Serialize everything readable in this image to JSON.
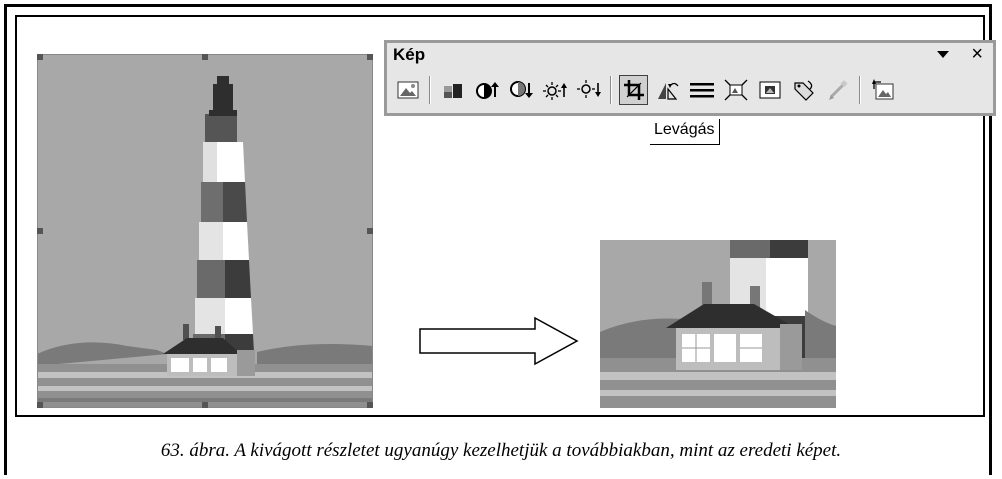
{
  "toolbar": {
    "title": "Kép",
    "dropdown_icon": "dropdown-arrow-icon",
    "close_label": "×",
    "buttons": [
      {
        "name": "insert-picture-icon"
      },
      {
        "name": "color-icon"
      },
      {
        "name": "more-contrast-icon"
      },
      {
        "name": "less-contrast-icon"
      },
      {
        "name": "more-brightness-icon"
      },
      {
        "name": "less-brightness-icon"
      },
      {
        "name": "crop-icon",
        "active": true
      },
      {
        "name": "rotate-left-icon"
      },
      {
        "name": "line-style-icon"
      },
      {
        "name": "compress-pictures-icon"
      },
      {
        "name": "text-wrapping-icon"
      },
      {
        "name": "format-picture-icon"
      },
      {
        "name": "set-transparent-color-icon"
      },
      {
        "name": "reset-picture-icon"
      }
    ]
  },
  "tooltip": {
    "text": "Levágás"
  },
  "caption": {
    "text": "63. ábra. A kivágott részletet ugyanúgy kezelhetjük a továbbiakban, mint az eredeti képet."
  },
  "colors": {
    "sky": "#a6a6a6",
    "dark": "#3a3a3a",
    "white": "#ffffff",
    "toolbar_bg": "#e6e6e6"
  }
}
